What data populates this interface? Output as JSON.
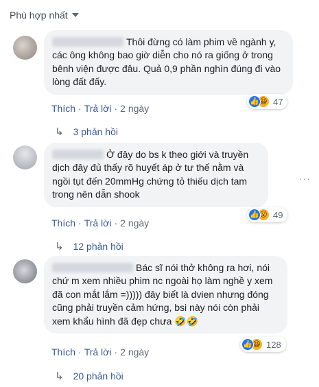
{
  "sort": {
    "label": "Phù hợp nhất"
  },
  "comments": [
    {
      "text": "Thôi đừng có làm phim về ngành y, các ông không bao giờ diễn cho nó ra giống ở trong bênh viện được đâu. Quả 0,9 phần nghìn đúng đi vào lòng đất đấy.",
      "like_label": "Thích",
      "reply_label": "Trả lời",
      "time": "2 ngày",
      "reaction_count": "47",
      "reaction_icons": [
        "like-icon",
        "haha-icon"
      ],
      "replies_label": "3 phản hồi"
    },
    {
      "text": "Ở đây do bs k theo giới và truyền dịch đây đủ thấy rõ huyết áp ở tư thế nằm và ngồi tụt đến 20mmHg chứng tỏ thiếu dịch tam trong nên dẫn shook",
      "like_label": "Thích",
      "reply_label": "Trả lời",
      "time": "2 ngày",
      "reaction_count": "49",
      "reaction_icons": [
        "like-icon",
        "wow-icon"
      ],
      "replies_label": "12 phản hồi"
    },
    {
      "text": "Bác sĩ nói thở không ra hơi, nói chứ m xem nhiều phim nc ngoài họ làm nghề y xem đã con mắt lắm =))))) đây biết là dvien nhưng đóng cũng phải truyền cảm hứng, bsi này nói còn phải xem khẩu hình đã đẹp chưa",
      "like_label": "Thích",
      "reply_label": "Trả lời",
      "time": "2 ngày",
      "reaction_count": "128",
      "reaction_icons": [
        "like-icon",
        "haha-icon"
      ],
      "replies_label": "20 phản hồi"
    }
  ],
  "colors": {
    "link": "#385898",
    "bubble": "#f2f3f5",
    "muted": "#606770",
    "like_blue": "#1877f2",
    "emoji_yellow": "#f7b125"
  }
}
